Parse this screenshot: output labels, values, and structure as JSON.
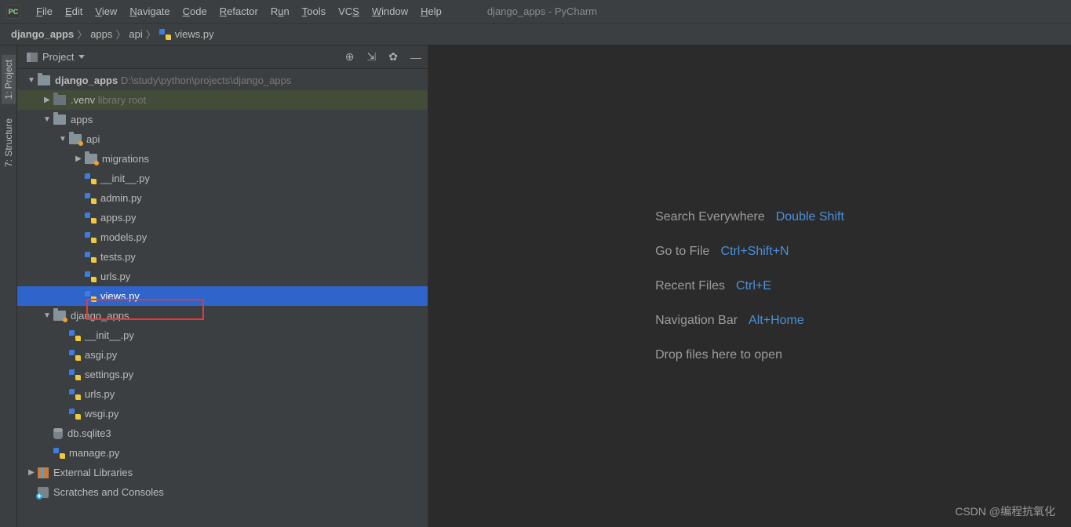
{
  "window": {
    "title": "django_apps - PyCharm"
  },
  "menubar": [
    "File",
    "Edit",
    "View",
    "Navigate",
    "Code",
    "Refactor",
    "Run",
    "Tools",
    "VCS",
    "Window",
    "Help"
  ],
  "breadcrumb": {
    "items": [
      "django_apps",
      "apps",
      "api",
      "views.py"
    ]
  },
  "panel": {
    "title": "Project"
  },
  "tree": {
    "root": {
      "name": "django_apps",
      "path": "D:\\study\\python\\projects\\django_apps"
    },
    "venv": {
      "name": ".venv",
      "tag": "library root"
    },
    "apps": "apps",
    "api": "api",
    "migrations": "migrations",
    "api_files": [
      "__init__.py",
      "admin.py",
      "apps.py",
      "models.py",
      "tests.py",
      "urls.py",
      "views.py"
    ],
    "django_apps": "django_apps",
    "django_files": [
      "__init__.py",
      "asgi.py",
      "settings.py",
      "urls.py",
      "wsgi.py"
    ],
    "dbsqlite": "db.sqlite3",
    "managepy": "manage.py",
    "ext": "External Libraries",
    "scratch": "Scratches and Consoles"
  },
  "sidebar": {
    "project": "1: Project",
    "structure": "7: Structure"
  },
  "hints": {
    "searchEverywhere": {
      "label": "Search Everywhere",
      "key": "Double Shift"
    },
    "goToFile": {
      "label": "Go to File",
      "key": "Ctrl+Shift+N"
    },
    "recentFiles": {
      "label": "Recent Files",
      "key": "Ctrl+E"
    },
    "navBar": {
      "label": "Navigation Bar",
      "key": "Alt+Home"
    },
    "drop": "Drop files here to open"
  },
  "watermark": "CSDN @编程抗氧化"
}
